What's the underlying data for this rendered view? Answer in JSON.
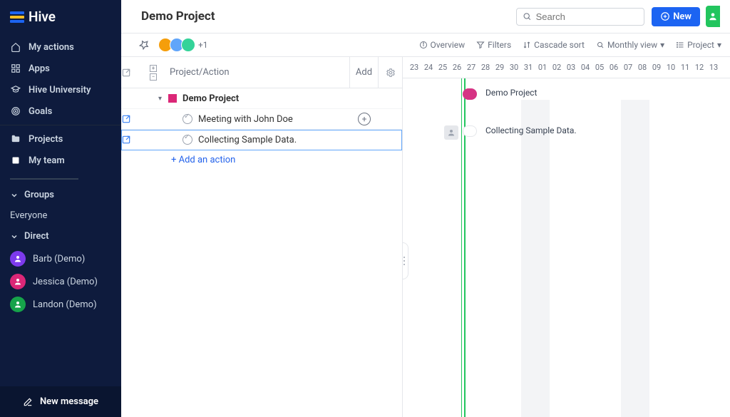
{
  "brand": "Hive",
  "sidebar": {
    "nav": [
      {
        "icon": "home",
        "label": "My actions"
      },
      {
        "icon": "apps",
        "label": "Apps"
      },
      {
        "icon": "grad",
        "label": "Hive University"
      },
      {
        "icon": "target",
        "label": "Goals"
      }
    ],
    "nav2": [
      {
        "icon": "folder",
        "label": "Projects"
      },
      {
        "icon": "square",
        "label": "My team"
      }
    ],
    "groups_label": "Groups",
    "everyone_label": "Everyone",
    "direct_label": "Direct",
    "people": [
      {
        "name": "Barb (Demo)"
      },
      {
        "name": "Jessica (Demo)"
      },
      {
        "name": "Landon (Demo)"
      }
    ],
    "new_message": "New message"
  },
  "header": {
    "title": "Demo Project",
    "search_placeholder": "Search",
    "new_label": "New"
  },
  "subbar": {
    "plus_count": "+1",
    "overview": "Overview",
    "filters": "Filters",
    "cascade": "Cascade sort",
    "view": "Monthly view",
    "project": "Project"
  },
  "tasklist": {
    "col_label": "Project/Action",
    "add_label": "Add",
    "project_name": "Demo Project",
    "tasks": [
      {
        "name": "Meeting with John Doe"
      },
      {
        "name": "Collecting Sample Data."
      }
    ],
    "add_action": "+ Add an action"
  },
  "gantt": {
    "days": [
      "23",
      "24",
      "25",
      "26",
      "27",
      "28",
      "29",
      "30",
      "31",
      "01",
      "02",
      "03",
      "04",
      "05",
      "06",
      "07",
      "08",
      "09",
      "10",
      "11",
      "12",
      "13"
    ],
    "label1": "Demo Project",
    "label2": "Collecting Sample Data."
  }
}
